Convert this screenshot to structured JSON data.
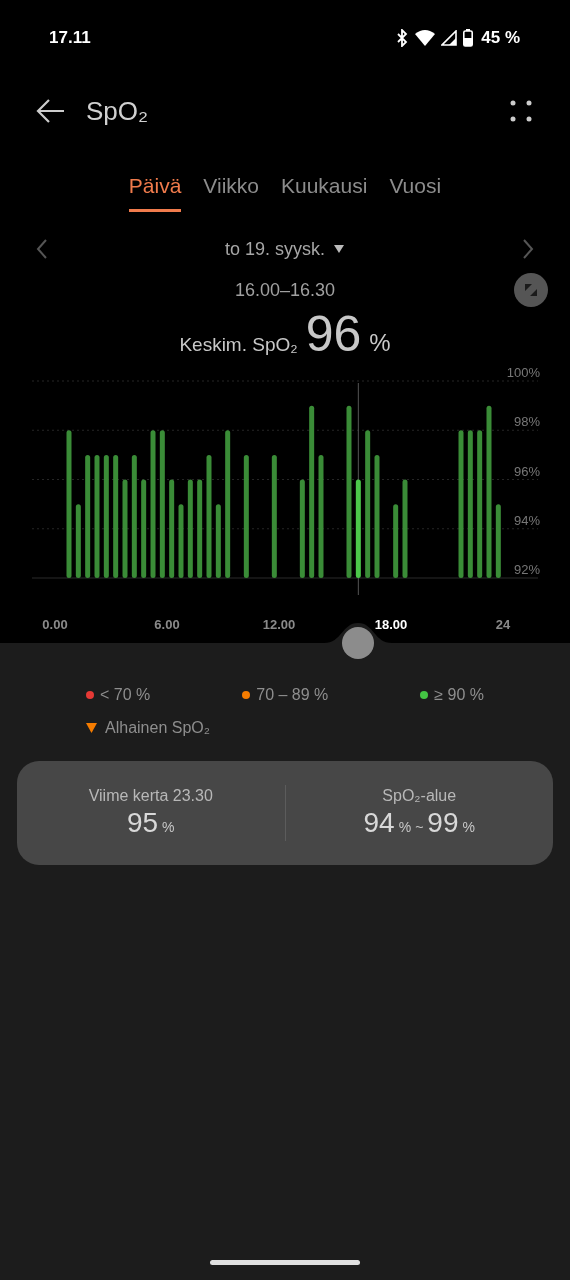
{
  "status_bar": {
    "time": "17.11",
    "battery": "45 %"
  },
  "header": {
    "title": "SpO₂"
  },
  "tabs": [
    {
      "label": "Päivä",
      "selected": true
    },
    {
      "label": "Viikko",
      "selected": false
    },
    {
      "label": "Kuukausi",
      "selected": false
    },
    {
      "label": "Vuosi",
      "selected": false
    }
  ],
  "date_nav": {
    "date": "to 19. syysk."
  },
  "summary": {
    "time_range": "16.00–16.30",
    "label": "Keskim. SpO₂",
    "value": "96",
    "unit": "%"
  },
  "chart": {
    "chart_data": {
      "type": "bar",
      "x": [
        0.75,
        1.25,
        1.75,
        2.25,
        2.75,
        3.25,
        3.75,
        4.25,
        4.75,
        5.25,
        5.75,
        6.25,
        6.75,
        7.25,
        7.75,
        8.25,
        8.75,
        9.25,
        10.25,
        11.75,
        13.25,
        13.75,
        14.25,
        15.75,
        16.25,
        16.75,
        17.25,
        18.25,
        18.75,
        21.75,
        22.25,
        22.75,
        23.25,
        23.75
      ],
      "xlim": [
        0,
        24
      ],
      "grid": true,
      "ref_lines": [
        {
          "axis": "x",
          "value": 16.25
        }
      ],
      "series": [
        {
          "color": "#3a8c37",
          "values": [
            98,
            95,
            97,
            97,
            97,
            97,
            96,
            97,
            96,
            98,
            98,
            96,
            95,
            96,
            96,
            97,
            95,
            98,
            97,
            97,
            96,
            99,
            97,
            99,
            null,
            98,
            97,
            95,
            96,
            98,
            98,
            98,
            99,
            95
          ]
        },
        {
          "color": "#4cc84a",
          "values": [
            null,
            null,
            null,
            null,
            null,
            null,
            null,
            null,
            null,
            null,
            null,
            null,
            null,
            null,
            null,
            null,
            null,
            null,
            null,
            null,
            null,
            null,
            null,
            null,
            96,
            null,
            null,
            null,
            null,
            null,
            null,
            null,
            null,
            null
          ]
        }
      ],
      "ylim": [
        92,
        100
      ],
      "yticks": [
        {
          "value": 100,
          "label": "100%"
        },
        {
          "value": 98,
          "label": "98%"
        },
        {
          "value": 96,
          "label": "96%"
        },
        {
          "value": 94,
          "label": "94%"
        },
        {
          "value": 92,
          "label": "92%"
        }
      ],
      "xticks": [
        {
          "value": 0,
          "label": "0.00"
        },
        {
          "value": 6,
          "label": "6.00"
        },
        {
          "value": 12,
          "label": "12.00"
        },
        {
          "value": 18,
          "label": "18.00"
        },
        {
          "value": 24,
          "label": "24"
        }
      ]
    }
  },
  "legend": [
    {
      "label": "< 70 %",
      "color": "#e53935"
    },
    {
      "label": "70 – 89 %",
      "color": "#f57c00"
    },
    {
      "label": "≥ 90 %",
      "color": "#43c443"
    }
  ],
  "alert_legend": {
    "label": "Alhainen SpO₂"
  },
  "stats": [
    {
      "label": "Viime kerta 23.30",
      "parts": [
        {
          "kind": "num",
          "text": "95"
        },
        {
          "kind": "unit",
          "text": "%"
        }
      ]
    },
    {
      "label": "SpO₂-alue",
      "parts": [
        {
          "kind": "num",
          "text": "94"
        },
        {
          "kind": "unit",
          "text": "%"
        },
        {
          "kind": "unit",
          "text": "~"
        },
        {
          "kind": "num",
          "text": "99"
        },
        {
          "kind": "unit",
          "text": "%"
        }
      ]
    }
  ]
}
